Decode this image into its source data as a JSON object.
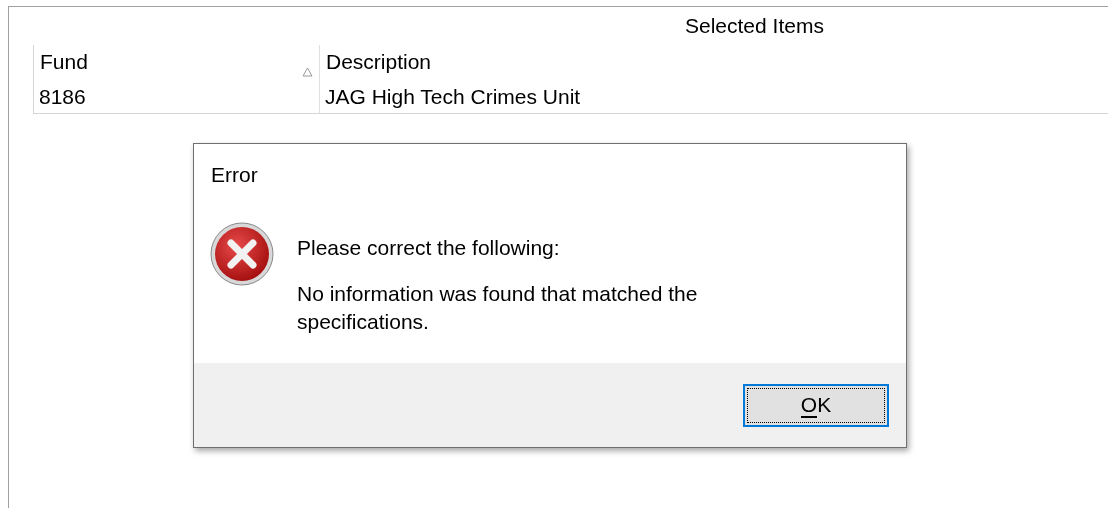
{
  "panel": {
    "title": "Selected Items"
  },
  "table": {
    "columns": [
      {
        "label": "Fund",
        "sorted": true
      },
      {
        "label": "Description",
        "sorted": false
      }
    ],
    "rows": [
      [
        "8186",
        "JAG High Tech Crimes Unit"
      ]
    ]
  },
  "dialog": {
    "title": "Error",
    "kind": "error",
    "messages": [
      "Please correct the following:",
      "No information was found that matched the specifications."
    ],
    "buttons": [
      {
        "label": "OK",
        "focused": true,
        "first_letter_underlined": true
      }
    ]
  }
}
